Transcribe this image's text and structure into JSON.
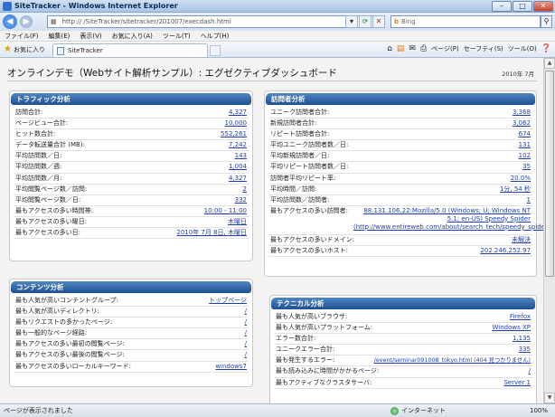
{
  "window": {
    "title": "SiteTracker - Windows Internet Explorer"
  },
  "address": {
    "url": "http://                /SiteTracker/sitetracker/201007/execdash.html",
    "search_placeholder": "Bing"
  },
  "menu": [
    "ファイル(F)",
    "編集(E)",
    "表示(V)",
    "お気に入り(A)",
    "ツール(T)",
    "ヘルプ(H)"
  ],
  "favorites": {
    "label": "お気に入り"
  },
  "tab": {
    "label": "SiteTracker"
  },
  "commandbar": {
    "page": "ページ(P)",
    "safety": "セーフティ(S)",
    "tools": "ツール(O)"
  },
  "page": {
    "title": "オンラインデモ（Webサイト解析サンプル）: エグゼクティブダッシュボード",
    "date": "2010年 7月"
  },
  "traffic": {
    "title": "トラフィック分析",
    "rows": [
      {
        "label": "訪問合計:",
        "value": "4,327"
      },
      {
        "label": "ページビュー合計:",
        "value": "10,000"
      },
      {
        "label": "ヒット数合計:",
        "value": "552,261"
      },
      {
        "label": "データ転送量合計 (MB):",
        "value": "7,242"
      },
      {
        "label": "平均訪問数／日:",
        "value": "143"
      },
      {
        "label": "平均訪問数／週:",
        "value": "1,004"
      },
      {
        "label": "平均訪問数／月:",
        "value": "4,327"
      },
      {
        "label": "平均閲覧ページ数／訪問:",
        "value": "2"
      },
      {
        "label": "平均閲覧ページ数／日:",
        "value": "332"
      },
      {
        "label": "最もアクセスの多い時間帯:",
        "value": "10:00 - 11:00"
      },
      {
        "label": "最もアクセスの多い曜日:",
        "value": "木曜日"
      },
      {
        "label": "最もアクセスの多い日:",
        "value": "2010年 7月 8日, 木曜日"
      }
    ]
  },
  "content": {
    "title": "コンテンツ分析",
    "rows": [
      {
        "label": "最も人気が高いコンテントグループ:",
        "value": "トップページ"
      },
      {
        "label": "最も人気が高いディレクトリ:",
        "value": "/"
      },
      {
        "label": "最もリクエストの多かったページ:",
        "value": "/"
      },
      {
        "label": "最も一般的なページ経路:",
        "value": "/"
      },
      {
        "label": "最もアクセスの多い最初の閲覧ページ:",
        "value": "/"
      },
      {
        "label": "最もアクセスの多い最後の閲覧ページ:",
        "value": "/"
      },
      {
        "label": "最もアクセスの多いローカルキーワード:",
        "value": "windows7"
      }
    ]
  },
  "visitor": {
    "title": "訪問者分析",
    "rows": [
      {
        "label": "ユニーク訪問者合計:",
        "value": "3,368"
      },
      {
        "label": "新規訪問者合計:",
        "value": "3,062"
      },
      {
        "label": "リピート訪問者合計:",
        "value": "674"
      },
      {
        "label": "平均ユニーク訪問者数／日:",
        "value": "131"
      },
      {
        "label": "平均新規訪問者／日:",
        "value": "102"
      },
      {
        "label": "平均リピート訪問者数／日:",
        "value": "35"
      },
      {
        "label": "訪問者平均リピート率:",
        "value": "20.0%"
      },
      {
        "label": "平均時間／訪問:",
        "value": "1分, 54 秒"
      },
      {
        "label": "平均訪問数／訪問者:",
        "value": "1"
      }
    ],
    "top_visitor_label": "最もアクセスの多い訪問者:",
    "top_visitor_value": "88.131.106.22:Mozilla/5.0 (Windows; U; Windows NT 5.1; en-US) Speedy Spider (http://www.entireweb.com/about/search_tech/speedy_spider/",
    "rows2": [
      {
        "label": "最もアクセスの多いドメイン:",
        "value": "未解決"
      },
      {
        "label": "最もアクセスの多いホスト:",
        "value": "202.246.252.97"
      }
    ]
  },
  "technical": {
    "title": "テクニカル分析",
    "rows": [
      {
        "label": "最も人気が高いブラウザ:",
        "value": "Firefox"
      },
      {
        "label": "最も人気が高いプラットフォーム:",
        "value": "Windows XP"
      },
      {
        "label": "エラー数合計:",
        "value": "1,135"
      },
      {
        "label": "ユニークエラー合計:",
        "value": "335"
      },
      {
        "label": "最も発生するエラー:",
        "value": "/event/seminar091008_tokyo.html (404 見つかりません)"
      },
      {
        "label": "最も読み込みに時間がかかるページ:",
        "value": "/"
      },
      {
        "label": "最もアクティブなクラスタサーバ:",
        "value": "Server 1"
      }
    ]
  },
  "status": {
    "message": "ページが表示されました",
    "zone": "インターネット",
    "zoom": "100%"
  }
}
